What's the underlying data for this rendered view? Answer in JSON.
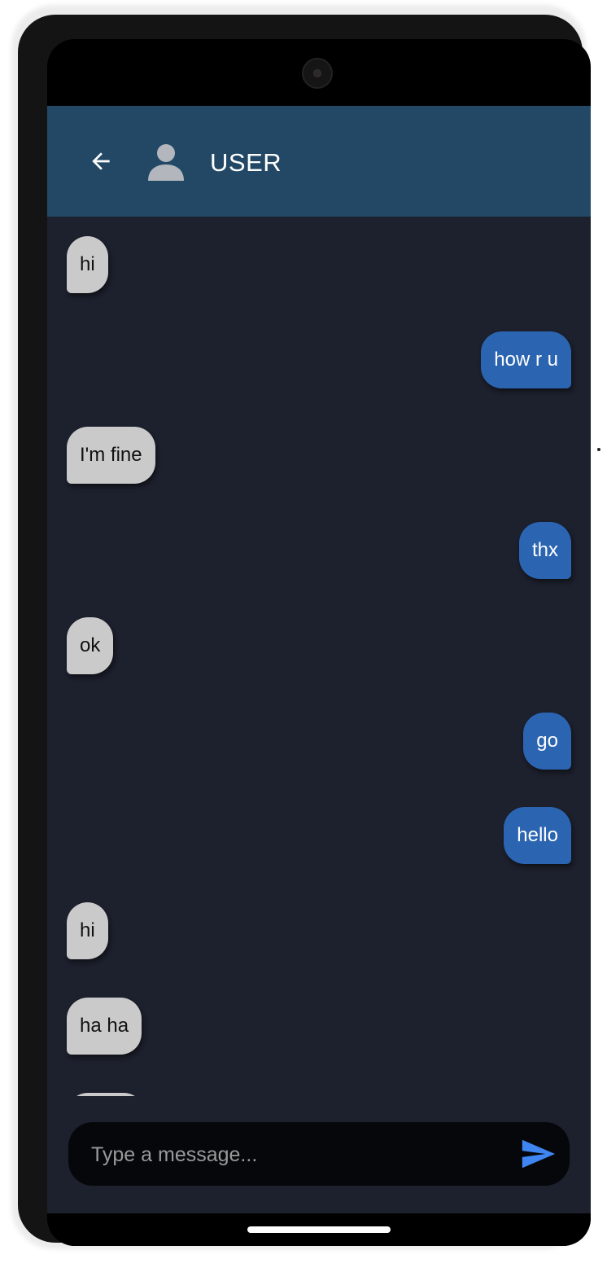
{
  "header": {
    "title": "USER",
    "back_icon": "arrow-left-icon",
    "avatar_icon": "person-icon",
    "bg_color": "#224866"
  },
  "messages": [
    {
      "text": "hi",
      "direction": "incoming"
    },
    {
      "text": "how r u",
      "direction": "outgoing"
    },
    {
      "text": "I'm fine",
      "direction": "incoming"
    },
    {
      "text": "thx",
      "direction": "outgoing"
    },
    {
      "text": "ok",
      "direction": "incoming"
    },
    {
      "text": "go",
      "direction": "outgoing"
    },
    {
      "text": "hello",
      "direction": "outgoing"
    },
    {
      "text": "hi",
      "direction": "incoming"
    },
    {
      "text": "ha ha",
      "direction": "incoming"
    }
  ],
  "composer": {
    "placeholder": "Type a message...",
    "value": "",
    "send_icon": "send-icon"
  },
  "colors": {
    "chat_bg": "#1d202d",
    "incoming_bubble": "#cacaca",
    "outgoing_bubble": "#2b65b2",
    "send_accent": "#3f86f2"
  }
}
